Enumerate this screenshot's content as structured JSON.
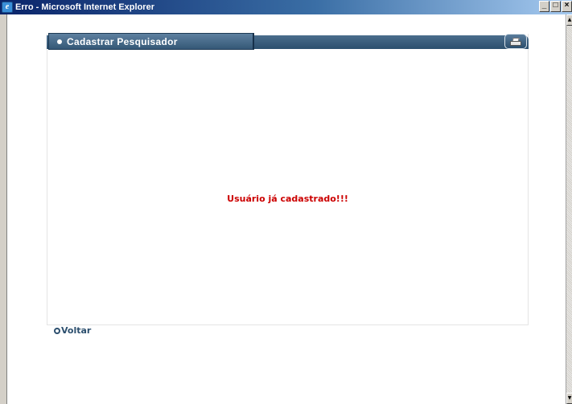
{
  "window": {
    "title": "Erro - Microsoft Internet Explorer",
    "minimize": "_",
    "maximize": "□",
    "close": "×"
  },
  "panel": {
    "title": "Cadastrar Pesquisador",
    "print_icon": "printer-icon"
  },
  "message": "Usuário já cadastrado!!!",
  "back_link": {
    "label": "Voltar",
    "icon": "circle-bullet-icon"
  },
  "colors": {
    "header_bg": "#2c4f6e",
    "message": "#cc0000",
    "link": "#2c4f6e"
  }
}
